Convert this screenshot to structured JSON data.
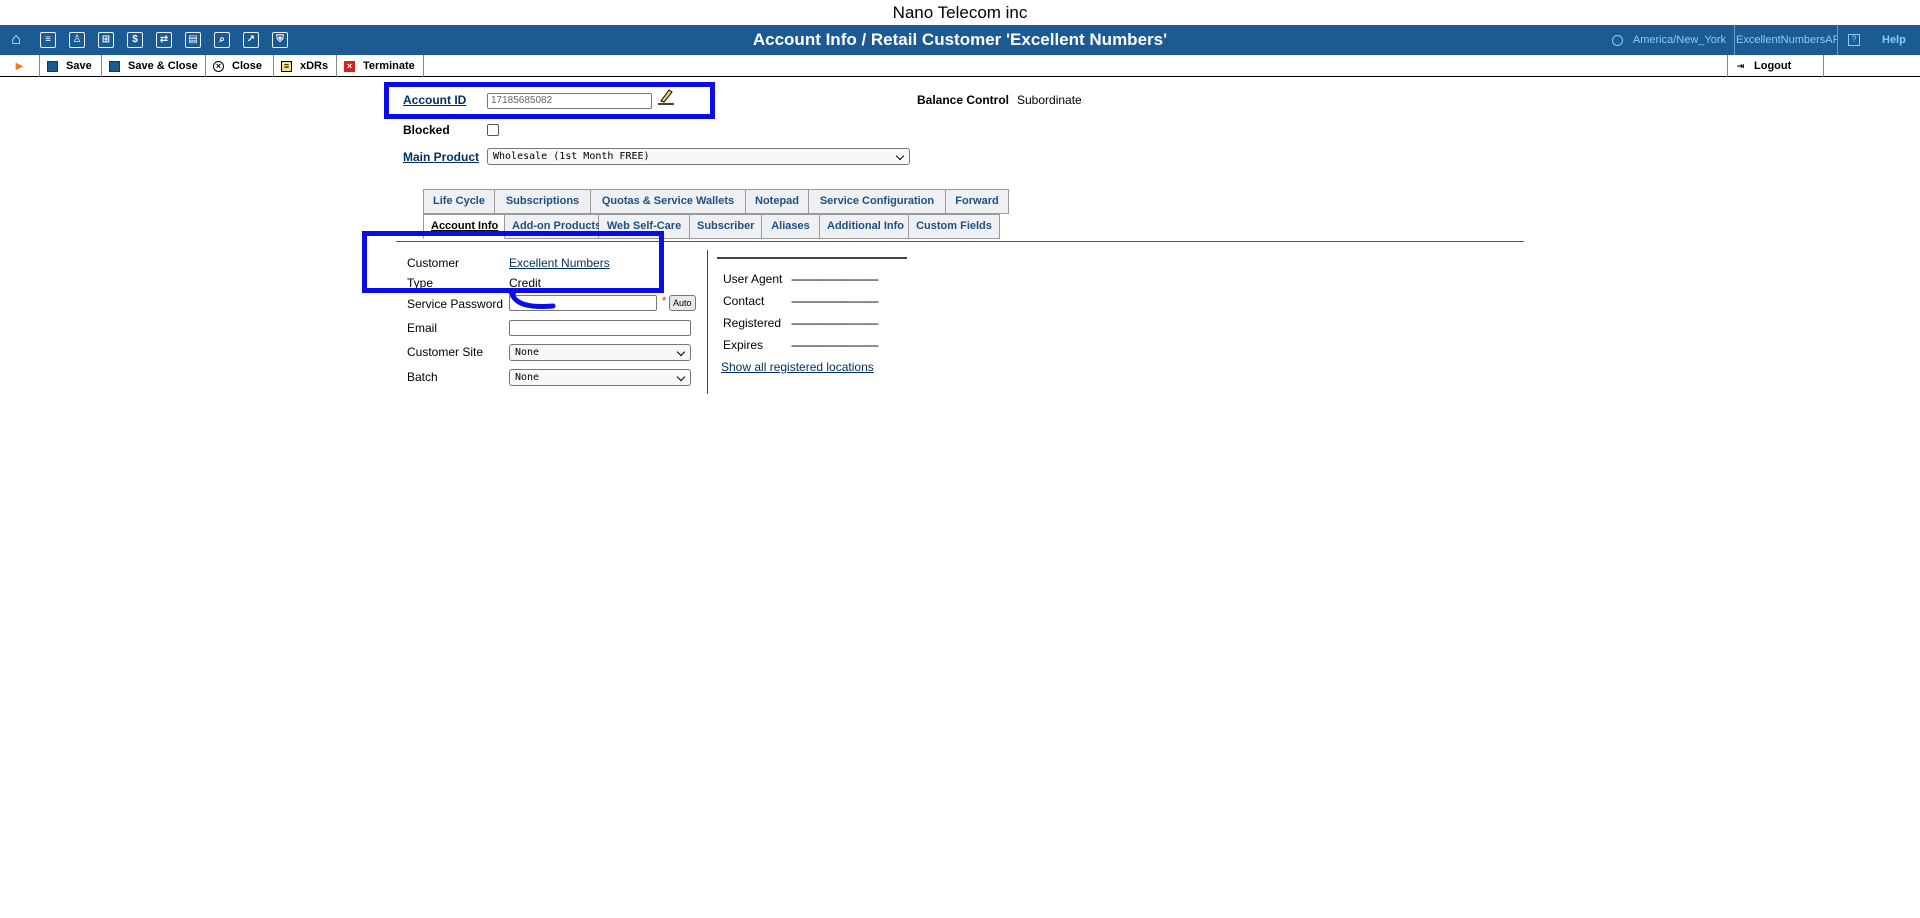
{
  "company": "Nano Telecom inc",
  "header": {
    "title": "Account Info / Retail Customer 'Excellent Numbers'",
    "timezone": "America/New_York",
    "user": "ExcellentNumbersAPI",
    "help": "Help",
    "nav_icons": [
      "home-icon",
      "list-icon",
      "person-icon",
      "grid-icon",
      "dollar-icon",
      "transfer-icon",
      "report-icon",
      "search-icon",
      "chart-icon",
      "shield-icon"
    ]
  },
  "toolbar": {
    "save": "Save",
    "save_close": "Save & Close",
    "close": "Close",
    "xdrs": "xDRs",
    "terminate": "Terminate",
    "logout": "Logout"
  },
  "account": {
    "account_id_label": "Account ID",
    "account_id_value": "17185685082",
    "blocked_label": "Blocked",
    "blocked": false,
    "main_product_label": "Main Product",
    "main_product_value": "Wholesale (1st Month FREE)",
    "balance_control_label": "Balance Control",
    "balance_control_value": "Subordinate"
  },
  "tabs": {
    "row1": [
      "Life Cycle",
      "Subscriptions",
      "Quotas & Service Wallets",
      "Notepad",
      "Service Configuration",
      "Forward"
    ],
    "row2": [
      "Account Info",
      "Add-on Products",
      "Web Self-Care",
      "Subscriber",
      "Aliases",
      "Additional Info",
      "Custom Fields"
    ],
    "active": "Account Info"
  },
  "info": {
    "customer_label": "Customer",
    "customer_value": "Excellent Numbers",
    "type_label": "Type",
    "type_value": "Credit",
    "service_password_label": "Service Password",
    "service_password_value": "",
    "required_mark": "*",
    "auto_button": "Auto",
    "email_label": "Email",
    "email_value": "",
    "customer_site_label": "Customer Site",
    "customer_site_value": "None",
    "batch_label": "Batch",
    "batch_value": "None"
  },
  "registration": {
    "user_agent_label": "User Agent",
    "contact_label": "Contact",
    "registered_label": "Registered",
    "expires_label": "Expires",
    "placeholder": "-----------------------------",
    "show_all_link": "Show all registered locations"
  },
  "annotation_color": "#0c0ce8"
}
